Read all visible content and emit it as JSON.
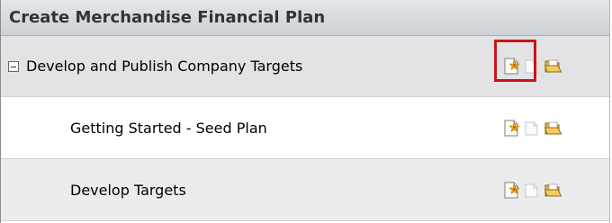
{
  "panel": {
    "title": "Create Merchandise Financial Plan"
  },
  "rows": [
    {
      "label": "Develop and Publish Company Targets",
      "actions": [
        "new-document-icon",
        "page-icon",
        "open-folder-icon"
      ],
      "highlighted_action": "new-document-icon"
    },
    {
      "label": "Getting Started - Seed Plan",
      "actions": [
        "new-document-icon",
        "page-icon",
        "open-folder-icon"
      ]
    },
    {
      "label": "Develop Targets",
      "actions": [
        "new-document-icon",
        "page-icon",
        "open-folder-icon"
      ]
    }
  ],
  "colors": {
    "highlight_border": "#c8141a",
    "header_background": "#cdd2d8",
    "group_row_background": "#e3e3e5"
  }
}
